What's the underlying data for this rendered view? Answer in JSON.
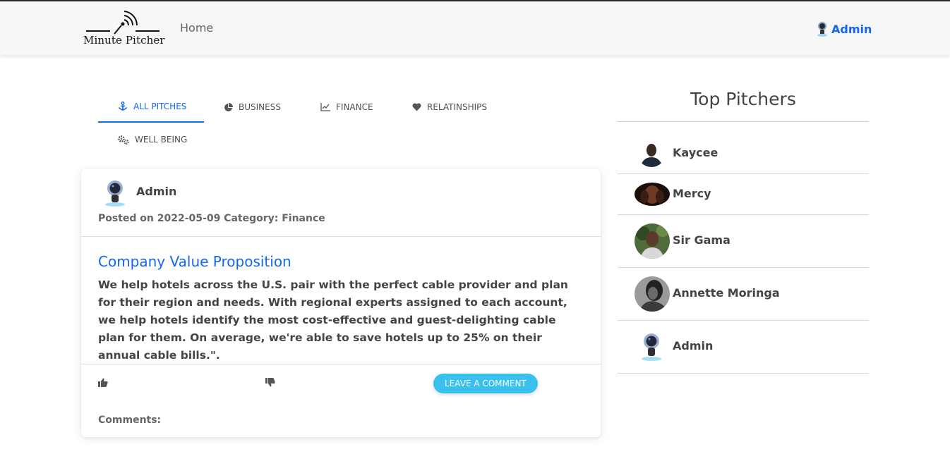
{
  "nav": {
    "brand": "Minute Pitcher",
    "home": "Home",
    "user": "Admin",
    "user_avatar_icon": "astronaut-avatar-icon"
  },
  "tabs": [
    {
      "label": "ALL PITCHES",
      "icon": "anchor-icon",
      "active": true
    },
    {
      "label": "BUSINESS",
      "icon": "pie-chart-icon",
      "active": false
    },
    {
      "label": "FINANCE",
      "icon": "line-chart-icon",
      "active": false
    },
    {
      "label": "RELATINSHIPS",
      "icon": "heart-icon",
      "active": false
    },
    {
      "label": "WELL BEING",
      "icon": "cogs-icon",
      "active": false
    }
  ],
  "post": {
    "author": "Admin",
    "meta": "Posted on 2022-05-09 Category: Finance",
    "title": "Company Value Proposition",
    "body": "We help hotels across the U.S. pair with the perfect cable provider and plan for their region and needs. With regional experts assigned to each account, we help hotels identify the most cost-effective and guest-delighting cable plan for them. On average, we're able to save hotels up to 25% on their annual cable bills.\".",
    "comment_button": "LEAVE A COMMENT",
    "comments_label": "Comments:"
  },
  "sidebar": {
    "title": "Top Pitchers",
    "pitchers": [
      {
        "name": "Kaycee"
      },
      {
        "name": "Mercy"
      },
      {
        "name": "Sir Gama"
      },
      {
        "name": "Annette Moringa"
      },
      {
        "name": "Admin"
      }
    ]
  },
  "colors": {
    "accent": "#1266f1",
    "info": "#39c0ed",
    "text": "#4f4f4f",
    "navbar_bg": "#f7f7f7"
  }
}
